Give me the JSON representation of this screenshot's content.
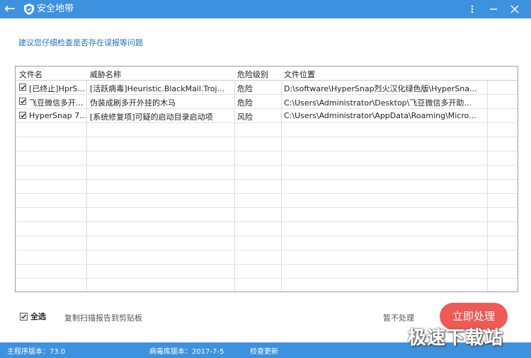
{
  "window": {
    "title": "安全地带",
    "back_icon": "back-arrow-icon",
    "logo_icon": "shield-icon",
    "menu_icon": "menu-icon",
    "minimize_icon": "minimize-icon",
    "close_icon": "close-icon"
  },
  "hint": "建议您仔细检查是否存在误报等问题",
  "table": {
    "columns": [
      "文件名",
      "威胁名称",
      "危险级别",
      "文件位置"
    ],
    "rows": [
      {
        "checked": true,
        "name": "[已终止]HprS...",
        "threat": "[活跃病毒]Heuristic.BlackMail.Troj...",
        "level": "危险",
        "path": "D:\\software\\HyperSnap烈火汉化绿色版\\HyperSna..."
      },
      {
        "checked": true,
        "name": "飞豆微信多开...",
        "threat": "伪装成刷多开外挂的木马",
        "level": "危险",
        "path": "C:\\Users\\Administrator\\Desktop\\飞豆微信多开助..."
      },
      {
        "checked": true,
        "name": "HyperSnap 7...",
        "threat": "[系统修复项]可疑的启动目录启动项",
        "level": "风险",
        "path": "C:\\Users\\Administrator\\AppData\\Roaming\\Micro..."
      }
    ]
  },
  "footer": {
    "select_all_label": "全选",
    "select_all_checked": true,
    "copy_report_label": "复制扫描报告到剪贴板",
    "skip_label": "暂不处理",
    "process_label": "立即处理"
  },
  "statusbar": {
    "program_version": "主程序版本：73.0",
    "virus_db_version": "病毒库版本：2017-7-5",
    "check_update": "检查更新"
  },
  "watermark": "极速下载站",
  "colors": {
    "accent": "#3d92e0",
    "hint_text": "#1f6fc7",
    "process_button": "#f05a55"
  }
}
